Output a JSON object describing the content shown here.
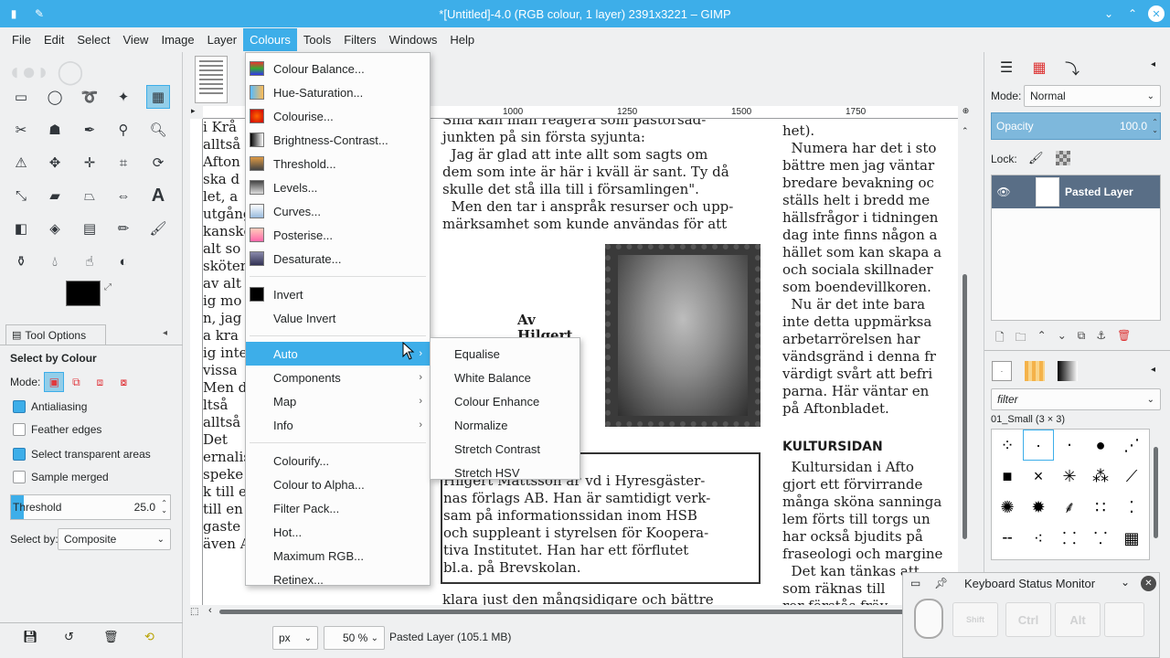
{
  "window": {
    "title": "*[Untitled]-4.0 (RGB colour, 1 layer) 2391x3221 – GIMP"
  },
  "menubar": [
    "File",
    "Edit",
    "Select",
    "View",
    "Image",
    "Layer",
    "Colours",
    "Tools",
    "Filters",
    "Windows",
    "Help"
  ],
  "colours_menu": {
    "group1": [
      "Colour Balance...",
      "Hue-Saturation...",
      "Colourise...",
      "Brightness-Contrast...",
      "Threshold...",
      "Levels...",
      "Curves...",
      "Posterise...",
      "Desaturate..."
    ],
    "group2": [
      "Invert",
      "Value Invert"
    ],
    "group3": [
      "Auto",
      "Components",
      "Map",
      "Info"
    ],
    "group4": [
      "Colourify...",
      "Colour to Alpha...",
      "Filter Pack...",
      "Hot...",
      "Maximum RGB...",
      "Retinex..."
    ]
  },
  "auto_submenu": [
    "Equalise",
    "White Balance",
    "Colour Enhance",
    "Normalize",
    "Stretch Contrast",
    "Stretch HSV"
  ],
  "tool_options": {
    "tab": "Tool Options",
    "title": "Select by Colour",
    "mode_label": "Mode:",
    "antialiasing": "Antialiasing",
    "feather": "Feather edges",
    "transparent": "Select transparent areas",
    "sample_merged": "Sample merged",
    "threshold_label": "Threshold",
    "threshold_value": "25.0",
    "select_by_label": "Select by:",
    "select_by_value": "Composite"
  },
  "ruler": [
    "1000",
    "1250",
    "1500",
    "1750"
  ],
  "layers": {
    "mode_label": "Mode:",
    "mode_value": "Normal",
    "opacity_label": "Opacity",
    "opacity_value": "100.0",
    "lock_label": "Lock:",
    "layer_name": "Pasted Layer"
  },
  "brushes": {
    "filter_placeholder": "filter",
    "current": "01_Small (3 × 3)"
  },
  "status": {
    "unit": "px",
    "zoom": "50 %",
    "info": "Pasted Layer (105.1 MB)"
  },
  "keyboard_monitor": {
    "title": "Keyboard Status Monitor",
    "keys": [
      "Shift",
      "Ctrl",
      "Alt",
      ""
    ]
  },
  "newspaper": {
    "col_left": [
      "i Krå",
      "alltså",
      "Afton",
      "ska d",
      "let, a",
      "utgång",
      "kanske",
      "alt so",
      "sköten",
      "av alt",
      "ig mo",
      "n, jag",
      "a kra",
      "ig inte",
      "vissa",
      "Men d",
      "ltså",
      "alltså",
      "Det",
      "ernalis",
      "speke",
      "k till e",
      "till en",
      "gaste",
      "även Aftonbladet till en del"
    ],
    "col_mid_top": [
      "Sina kan man reagera som pastorsad-",
      "junkten på sin första syjunta:",
      "  Jag är glad att inte allt som sagts om",
      "dem som inte är här i kväll är sant. Ty då",
      "skulle det stå illa till i församlingen\".",
      "  Men den tar i anspråk resurser och upp-",
      "märksamhet som kunde användas för att"
    ],
    "byline": [
      "Av",
      "Hilgert"
    ],
    "col_right": [
      "het).",
      "  Numera har det i sto",
      "bättre men jag väntar",
      "bredare bevakning oc",
      "ställs helt i bredd me",
      "hällsfrågor i tidningen",
      "dag inte finns någon a",
      "hället som kan skapa a",
      "och sociala skillnader",
      "som boendevillkoren.",
      "  Nu är det inte bara",
      "inte detta uppmärksa",
      "arbetarrörelsen har",
      "vändsgränd i denna fr",
      "värdigt svårt att befri",
      "parna. Här väntar en",
      "på Aftonbladet."
    ],
    "heading": "KULTURSIDAN",
    "col_right2": [
      "  Kultursidan i Afto",
      "gjort ett förvirrande",
      "många sköna sanninga",
      "lem förts till torgs un",
      "har också bjudits på",
      "fraseologi och margine",
      "  Det kan tänkas att",
      "som räknas till",
      "ror förstås fräv"
    ],
    "box": [
      "Hilgert Mattsson är vd i Hyresgäster-",
      "nas förlags AB. Han är samtidigt verk-",
      "sam på informationssidan inom HSB",
      "och suppleant i styrelsen för Koopera-",
      "tiva Institutet. Han har ett förflutet",
      "bl.a. på Brevskolan."
    ],
    "bottom": "klara just den mångsidigare och bättre"
  }
}
